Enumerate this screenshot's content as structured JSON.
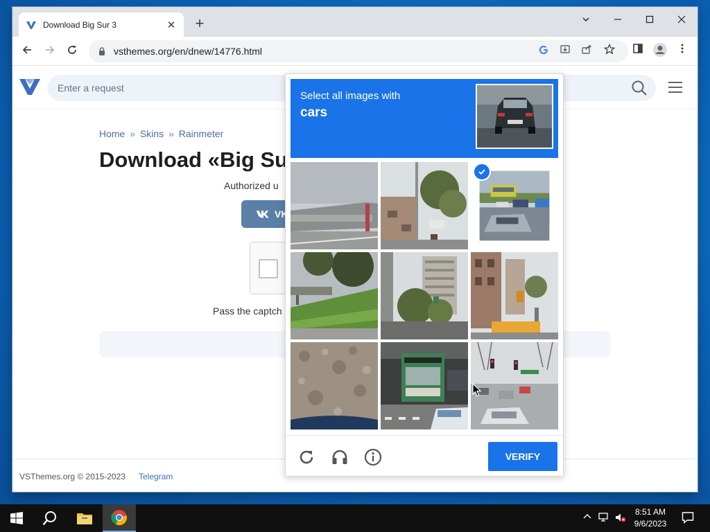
{
  "browser": {
    "tab_title": "Download Big Sur 3",
    "url": "vsthemes.org/en/dnew/14776.html",
    "new_tab": "+",
    "close_tab": "✕"
  },
  "site": {
    "search_placeholder": "Enter a request",
    "breadcrumb": [
      "Home",
      "Skins",
      "Rainmeter"
    ],
    "breadcrumb_sep": "»",
    "title": "Download «Big Su",
    "authorized_text": "Authorized u",
    "vk_label": "VK",
    "pass_text": "Pass the captch",
    "copyright": "VSThemes.org © 2015-2023",
    "telegram": "Telegram"
  },
  "captcha": {
    "prompt_line1": "Select all images with",
    "prompt_target": "cars",
    "verify_label": "VERIFY",
    "tiles": [
      {
        "scene": "station",
        "selected": false
      },
      {
        "scene": "street-trees",
        "selected": false
      },
      {
        "scene": "traffic-bus",
        "selected": true
      },
      {
        "scene": "hill-bridge",
        "selected": false
      },
      {
        "scene": "tall-building",
        "selected": false
      },
      {
        "scene": "traffic-light-bus",
        "selected": false
      },
      {
        "scene": "ground",
        "selected": false
      },
      {
        "scene": "bus-front",
        "selected": false
      },
      {
        "scene": "intersection-cars",
        "selected": false
      }
    ]
  },
  "taskbar": {
    "time": "8:51 AM",
    "date": "9/6/2023"
  },
  "colors": {
    "accent": "#1a73e8",
    "site_link": "#4a6fa5",
    "vk": "#5b7fa6"
  }
}
